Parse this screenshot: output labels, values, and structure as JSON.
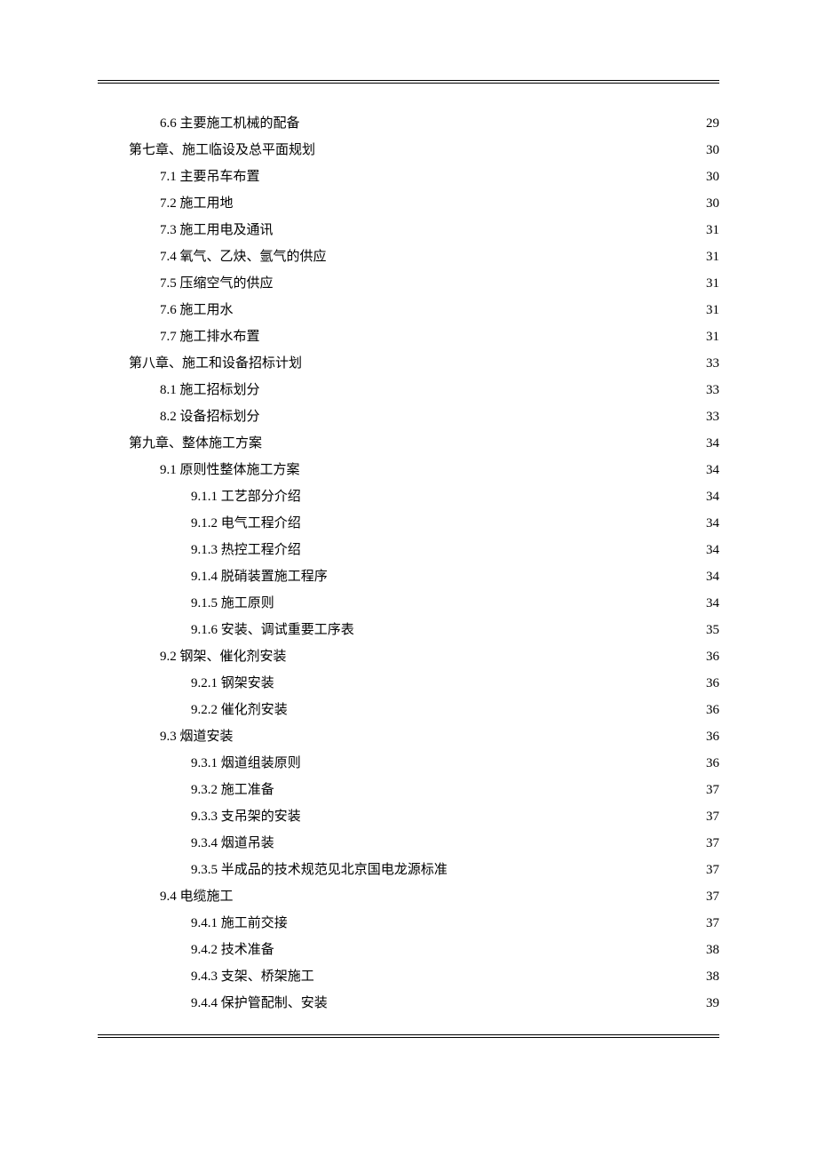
{
  "toc": [
    {
      "indent": 2,
      "label": "6.6 主要施工机械的配备",
      "page": "29"
    },
    {
      "indent": 1,
      "label": "第七章、施工临设及总平面规划",
      "page": "30"
    },
    {
      "indent": 2,
      "label": "7.1 主要吊车布置",
      "page": "30"
    },
    {
      "indent": 2,
      "label": "7.2 施工用地",
      "page": "30"
    },
    {
      "indent": 2,
      "label": "7.3 施工用电及通讯",
      "page": "31"
    },
    {
      "indent": 2,
      "label": "7.4 氧气、乙炔、氩气的供应",
      "page": "31"
    },
    {
      "indent": 2,
      "label": "7.5 压缩空气的供应",
      "page": "31"
    },
    {
      "indent": 2,
      "label": "7.6 施工用水",
      "page": "31"
    },
    {
      "indent": 2,
      "label": "7.7 施工排水布置",
      "page": "31"
    },
    {
      "indent": 1,
      "label": "第八章、施工和设备招标计划",
      "page": "33"
    },
    {
      "indent": 2,
      "label": "8.1 施工招标划分",
      "page": "33"
    },
    {
      "indent": 2,
      "label": "8.2 设备招标划分",
      "page": "33"
    },
    {
      "indent": 1,
      "label": "第九章、整体施工方案",
      "page": "34"
    },
    {
      "indent": 2,
      "label": "9.1 原则性整体施工方案",
      "page": "34"
    },
    {
      "indent": 3,
      "label": "9.1.1 工艺部分介绍",
      "page": "34"
    },
    {
      "indent": 3,
      "label": "9.1.2 电气工程介绍",
      "page": "34"
    },
    {
      "indent": 3,
      "label": "9.1.3 热控工程介绍",
      "page": "34"
    },
    {
      "indent": 3,
      "label": "9.1.4 脱硝装置施工程序",
      "page": "34"
    },
    {
      "indent": 3,
      "label": "9.1.5 施工原则",
      "page": "34"
    },
    {
      "indent": 3,
      "label": "9.1.6 安装、调试重要工序表",
      "page": "35"
    },
    {
      "indent": 2,
      "label": "9.2 钢架、催化剂安装",
      "page": "36"
    },
    {
      "indent": 3,
      "label": "9.2.1 钢架安装",
      "page": "36"
    },
    {
      "indent": 3,
      "label": "9.2.2 催化剂安装",
      "page": "36"
    },
    {
      "indent": 2,
      "label": "9.3 烟道安装",
      "page": "36"
    },
    {
      "indent": 3,
      "label": "9.3.1 烟道组装原则",
      "page": "36"
    },
    {
      "indent": 3,
      "label": "9.3.2 施工准备",
      "page": "37"
    },
    {
      "indent": 3,
      "label": "9.3.3 支吊架的安装",
      "page": "37"
    },
    {
      "indent": 3,
      "label": "9.3.4 烟道吊装",
      "page": "37"
    },
    {
      "indent": 3,
      "label": "9.3.5 半成品的技术规范见北京国电龙源标准",
      "page": "37"
    },
    {
      "indent": 2,
      "label": "9.4 电缆施工",
      "page": "37"
    },
    {
      "indent": 3,
      "label": "9.4.1 施工前交接",
      "page": "37"
    },
    {
      "indent": 3,
      "label": "9.4.2 技术准备",
      "page": "38"
    },
    {
      "indent": 3,
      "label": "9.4.3 支架、桥架施工",
      "page": "38"
    },
    {
      "indent": 3,
      "label": "9.4.4 保护管配制、安装",
      "page": "39"
    }
  ]
}
